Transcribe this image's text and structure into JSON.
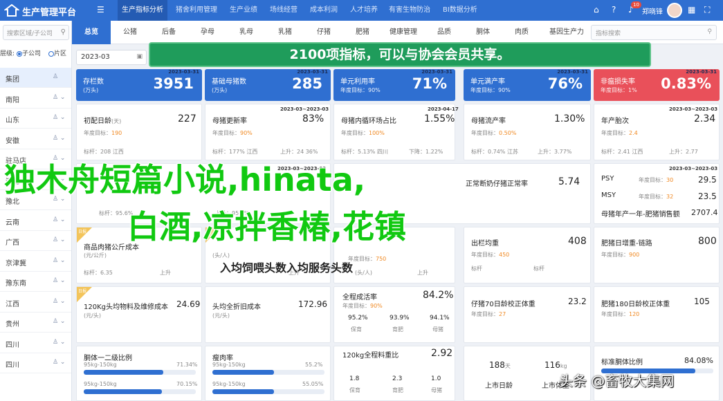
{
  "app": {
    "title": "生产管理平台",
    "collapse_icon": "menu-fold-icon"
  },
  "nav": {
    "tabs": [
      "生产指标分析",
      "猪舍利用管理",
      "生产业绩",
      "场线经营",
      "成本利润",
      "人才培养",
      "有害生物防治",
      "BI数据分析"
    ],
    "active": 0,
    "user": "郑晓锋",
    "badge": "10"
  },
  "sidebar": {
    "search_placeholder": "搜索区域/子公司",
    "filter_label": "层级:",
    "filter_opt1": "子公司",
    "filter_opt2": "片区",
    "items": [
      "集团",
      "南阳",
      "山东",
      "安徽",
      "驻马店",
      "河北",
      "豫北",
      "云南",
      "广西",
      "京津冀",
      "豫东南",
      "江西",
      "贵州",
      "四川",
      "四川"
    ]
  },
  "subtabs": {
    "items": [
      "总览",
      "公猪",
      "后备",
      "孕母",
      "乳母",
      "乳猪",
      "仔猪",
      "肥猪",
      "健康管理",
      "品质",
      "胴体",
      "肉质",
      "基因生产力"
    ],
    "search_placeholder": "指标搜索"
  },
  "date": "2023-03",
  "banner": "2100项指标，可以与协会会员共享。",
  "kpis": [
    {
      "name": "存栏数",
      "sub": "(万头)",
      "value": "3951",
      "date": "2023-03-31",
      "color": "#2f6fd1"
    },
    {
      "name": "基础母猪数",
      "sub": "(万头)",
      "value": "285",
      "date": "2023-03-31",
      "color": "#2f6fd1"
    },
    {
      "name": "单元利用率",
      "sub": "年度目标：90%",
      "value": "71%",
      "date": "2023-03-31",
      "color": "#2f6fd1"
    },
    {
      "name": "单元满产率",
      "sub": "年度目标：90%",
      "value": "76%",
      "date": "2023-03-31",
      "color": "#2f6fd1"
    },
    {
      "name": "非瘟损失率",
      "sub": "年度目标：1%",
      "value": "0.83%",
      "date": "2023-03-31",
      "color": "#e9505a"
    }
  ],
  "cards": {
    "c1": {
      "title": "初配日龄",
      "unit": "(天)",
      "value": "227",
      "target_label": "年度目标：",
      "target": "190",
      "bench": "标杆：208",
      "sup": "江西"
    },
    "c2": {
      "title": "母猪更新率",
      "value": "83%",
      "date": "2023-03~2023-03",
      "target_label": "年度目标：",
      "target": "90%",
      "bench": "标杆：177%",
      "sup": "江西",
      "ext": "上升：24 36%"
    },
    "c3": {
      "title": "母猪内循环场占比",
      "value": "1.55%",
      "date": "2023-04-17",
      "target_label": "年度目标：",
      "target": "100%",
      "bench": "标杆：5.13%",
      "sup": "四川",
      "ext": "下降：1.22%"
    },
    "c4": {
      "title": "母猪流产率",
      "value": "1.30%",
      "target_label": "年度目标：",
      "target": "0.50%",
      "bench": "标杆：0.74%",
      "sup": "江苏",
      "ext": "上升：3.77%"
    },
    "c5": {
      "title": "年产胎次",
      "value": "2.34",
      "date": "2023-03~2023-03",
      "target_label": "年度目标：",
      "target": "2.4",
      "bench": "标杆：2.41",
      "sup": "江西",
      "ext": "上升：2.77"
    },
    "c6": {
      "date": "2023-03~2023-03",
      "bench": "标杆：95.6%",
      "ext": "上升：95.2%"
    },
    "c7": {
      "title": "正常断奶仔猪正常率",
      "value": "5.74"
    },
    "c8": {
      "title": "商品肉猪公斤成本",
      "date": "2023-03~2023-03",
      "row1_name": "PSY",
      "row1_tgt": "30",
      "row1_val": "29.5",
      "row2_name": "MSY",
      "row2_tgt": "32",
      "row2_val": "23.5",
      "row3_name": "母猪年产一年-肥猪销售额",
      "row3_val": "2707.4"
    },
    "c9": {
      "title": "商品肉猪公斤成本",
      "unit": "(元/公斤)",
      "tag": "日报",
      "stat": "标杆：6.35",
      "ext": "上升"
    },
    "c10": {
      "title": "人均饲喂头数",
      "unit": "(头/人)",
      "ext": "上升"
    },
    "c11": {
      "title": "人均服务头数",
      "unit": "(头/人)",
      "tgt": "750",
      "ext": "上升"
    },
    "c12": {
      "title": "出栏均重",
      "value": "408",
      "tgt": "450",
      "a": "标杆",
      "b": "标杆"
    },
    "c13": {
      "title": "肥猪日增重-链路",
      "value": "800",
      "tgt": "900"
    },
    "c14": {
      "tag": "日报",
      "title": "120Kg头均物料及维修成本",
      "value": "24.69",
      "unit": "(元/头)"
    },
    "c15": {
      "title": "头均全折旧成本",
      "value": "172.96",
      "unit": "(元/头)"
    },
    "c16": {
      "title": "全程成活率",
      "value": "84.2%",
      "tgt": "90%",
      "a_val": "95.2%",
      "b_val": "93.9%",
      "c_val": "94.1%",
      "a_lbl": "保育",
      "b_lbl": "育肥",
      "c_lbl": "母猪"
    },
    "c17": {
      "title": "仔猪70日龄校正体重",
      "value": "23.2",
      "tgt": "27"
    },
    "c18": {
      "title": "肥猪180日龄校正体重",
      "value": "105",
      "tgt": "120"
    },
    "c19": {
      "title": "胴体一二级比例",
      "value": "71.34%",
      "sub": "95kg-150kg",
      "value2": "70.15%",
      "fill1": 0.71,
      "fill2": 0.7
    },
    "c20": {
      "title": "瘦肉率",
      "value": "55.2%",
      "sub": "95kg-150kg",
      "value2": "55.05%",
      "fill1": 0.55,
      "fill2": 0.55
    },
    "c21": {
      "title": "120kg全程料重比",
      "value": "2.92",
      "a_val": "1.8",
      "b_val": "2.3",
      "c_val": "1.0",
      "a_lbl": "保育",
      "b_lbl": "育肥",
      "c_lbl": "母猪"
    },
    "c22": {
      "v1": "188",
      "u1": "天",
      "v2": "116",
      "u2": "kg",
      "l1": "上市日龄",
      "l2": "上市体重"
    },
    "c23": {
      "title": "标准胴体比例",
      "value": "84.08%",
      "fill": 0.84
    }
  },
  "overlay": {
    "line1": "独木舟短篇小说,hinata,",
    "line2": "白酒,凉拌香椿,花镇",
    "line3": "入均饲喂头数入均服务头数"
  },
  "watermark": "头条 @畜牧大集网",
  "colors": {
    "primary": "#2f6fd1",
    "danger": "#e9505a",
    "accent": "#f08a24",
    "banner": "#1f9c5b",
    "overlay": "#11c911"
  }
}
